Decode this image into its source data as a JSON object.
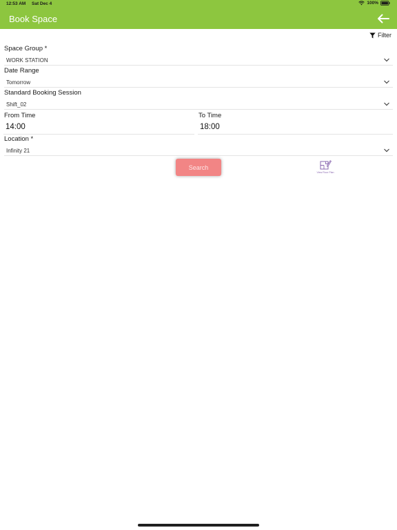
{
  "status_bar": {
    "time": "12:53 AM",
    "date": "Sat Dec 4",
    "battery": "100%",
    "wifi_icon": "wifi-icon",
    "battery_icon": "battery-icon"
  },
  "header": {
    "title": "Book Space",
    "back_icon": "arrow-left-icon",
    "color": "#8dc63f"
  },
  "filter": {
    "label": "Filter",
    "icon": "funnel-icon"
  },
  "form": {
    "space_group": {
      "label": "Space Group *",
      "value": "WORK STATION"
    },
    "date_range": {
      "label": "Date Range",
      "value": "Tomorrow"
    },
    "booking_session": {
      "label": "Standard Booking Session",
      "value": "Shift_02"
    },
    "from_time": {
      "label": "From Time",
      "value": "14:00"
    },
    "to_time": {
      "label": "To Time",
      "value": "18:00"
    },
    "location": {
      "label": "Location *",
      "value": "Infinity 21"
    }
  },
  "actions": {
    "search_label": "Search",
    "search_color": "#f28585",
    "floor_plan_label": "View Floor Plan",
    "floor_plan_icon": "edit-floor-plan-icon",
    "floor_plan_color": "#8a68b0"
  }
}
